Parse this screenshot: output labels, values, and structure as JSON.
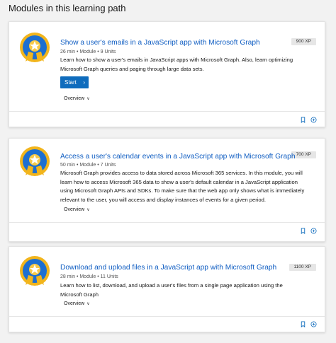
{
  "page": {
    "heading": "Modules in this learning path"
  },
  "modules": [
    {
      "title": "Show a user's emails in a JavaScript app with Microsoft Graph",
      "meta": "26 min • Module • 9 Units",
      "xp": "900 XP",
      "description": "Learn how to show a user's emails in JavaScript apps with Microsoft Graph. Also, learn optimizing Microsoft Graph queries and paging through large data sets.",
      "start_label": "Start",
      "overview_label": "Overview"
    },
    {
      "title": "Access a user's calendar events in a JavaScript app with Microsoft Graph",
      "meta": "50 min • Module • 7 Units",
      "xp": "700 XP",
      "description": "Microsoft Graph provides access to data stored across Microsoft 365 services. In this module, you will learn how to access Microsoft 365 data to show a user's default calendar in a JavaScript application using Microsoft Graph APIs and SDKs. To make sure that the web app only shows what is immediately relevant to the user, you will access and display instances of events for a given period.",
      "overview_label": "Overview"
    },
    {
      "title": "Download and upload files in a JavaScript app with Microsoft Graph",
      "meta": "28 min • Module • 11 Units",
      "xp": "1100 XP",
      "description": "Learn how to list, download, and upload a user's files from a single page application using the Microsoft Graph",
      "overview_label": "Overview"
    }
  ],
  "colors": {
    "link": "#0f5dc2",
    "button": "#0f6cbd",
    "badge_blue": "#1d6fd1",
    "badge_gold": "#f2b51c"
  },
  "icons": [
    "trophy-badge-icon",
    "chevron-right-icon",
    "chevron-down-icon",
    "bookmark-icon",
    "add-collection-icon"
  ]
}
